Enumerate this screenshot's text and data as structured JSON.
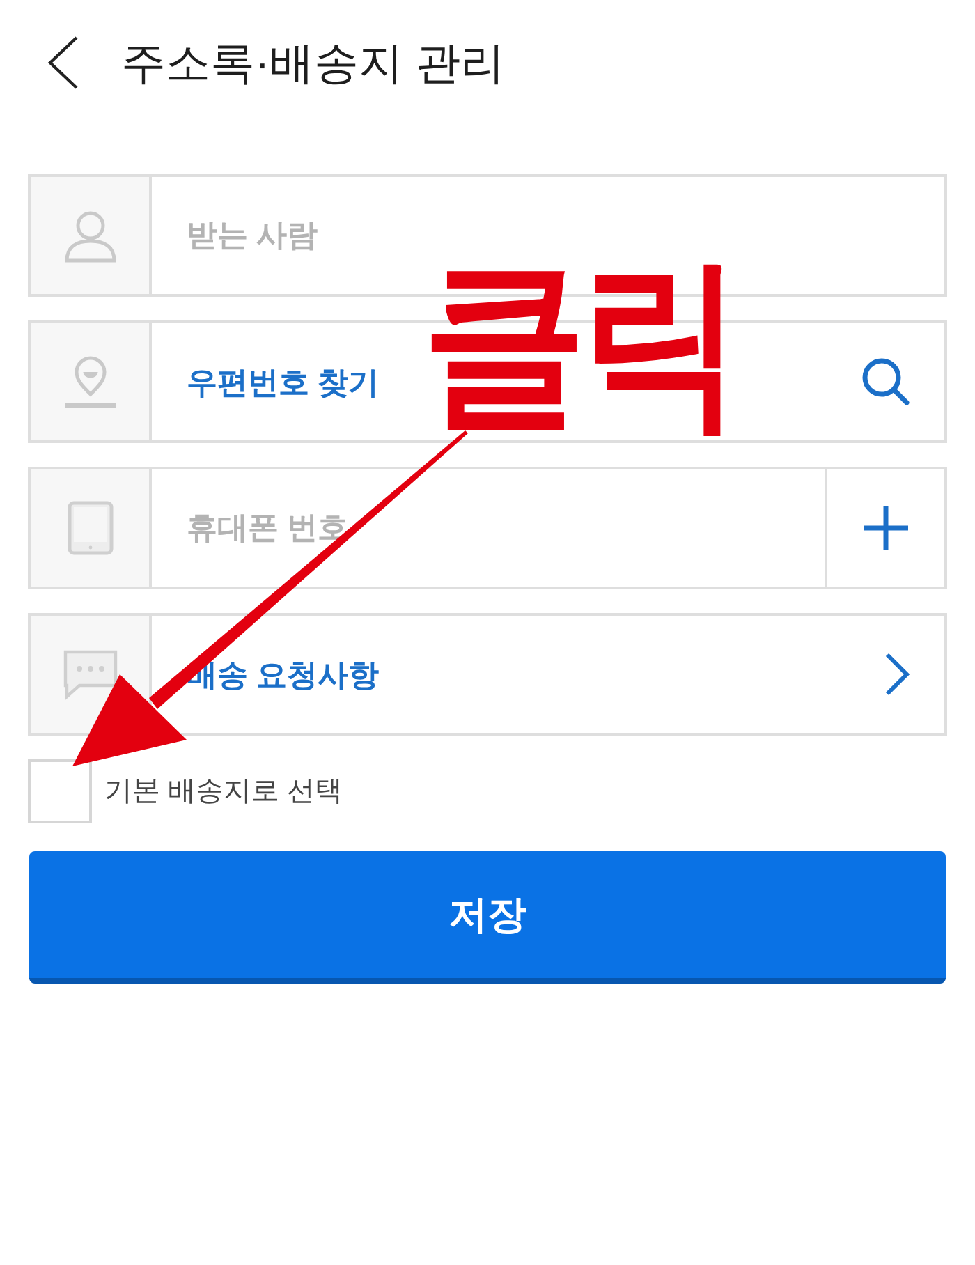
{
  "header": {
    "title": "주소록·배송지 관리"
  },
  "fields": [
    {
      "kind": "text",
      "placeholder": "받는 사람"
    },
    {
      "kind": "search",
      "label": "우편번호 찾기"
    },
    {
      "kind": "add",
      "placeholder": "휴대폰 번호"
    },
    {
      "kind": "link",
      "label": "배송 요청사항"
    }
  ],
  "default_address": {
    "label": "기본 배송지로 선택",
    "checked": false
  },
  "save_button": {
    "label": "저장"
  },
  "annotation": {
    "text": "클릭"
  }
}
